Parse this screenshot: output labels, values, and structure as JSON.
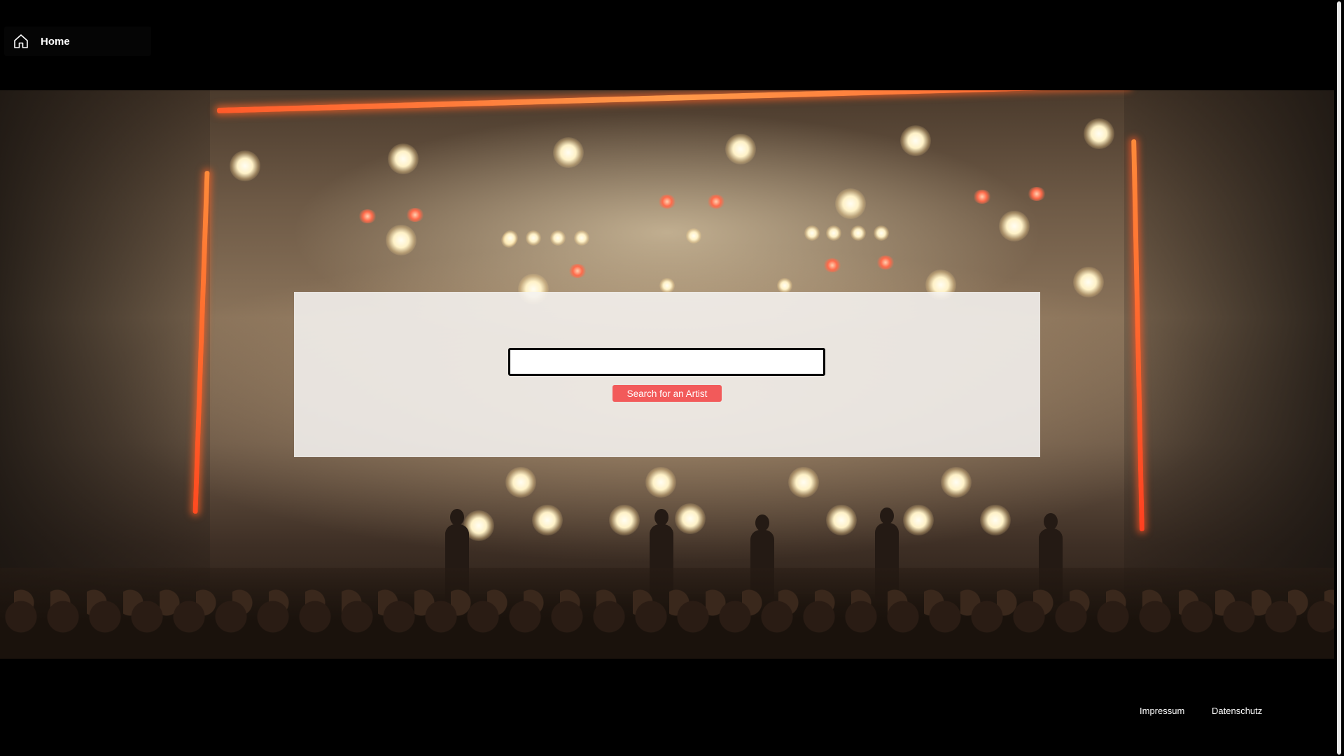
{
  "header": {
    "home_label": "Home",
    "home_icon": "home-icon"
  },
  "search": {
    "value": "",
    "placeholder": "",
    "button_label": "Search for an Artist",
    "button_color": "#f25a5a"
  },
  "footer": {
    "links": [
      {
        "label": "Impressum"
      },
      {
        "label": "Datenschutz"
      }
    ]
  },
  "colors": {
    "background": "#000000",
    "panel": "rgba(245,242,240,0.88)",
    "truss": "#ff5a2a"
  }
}
